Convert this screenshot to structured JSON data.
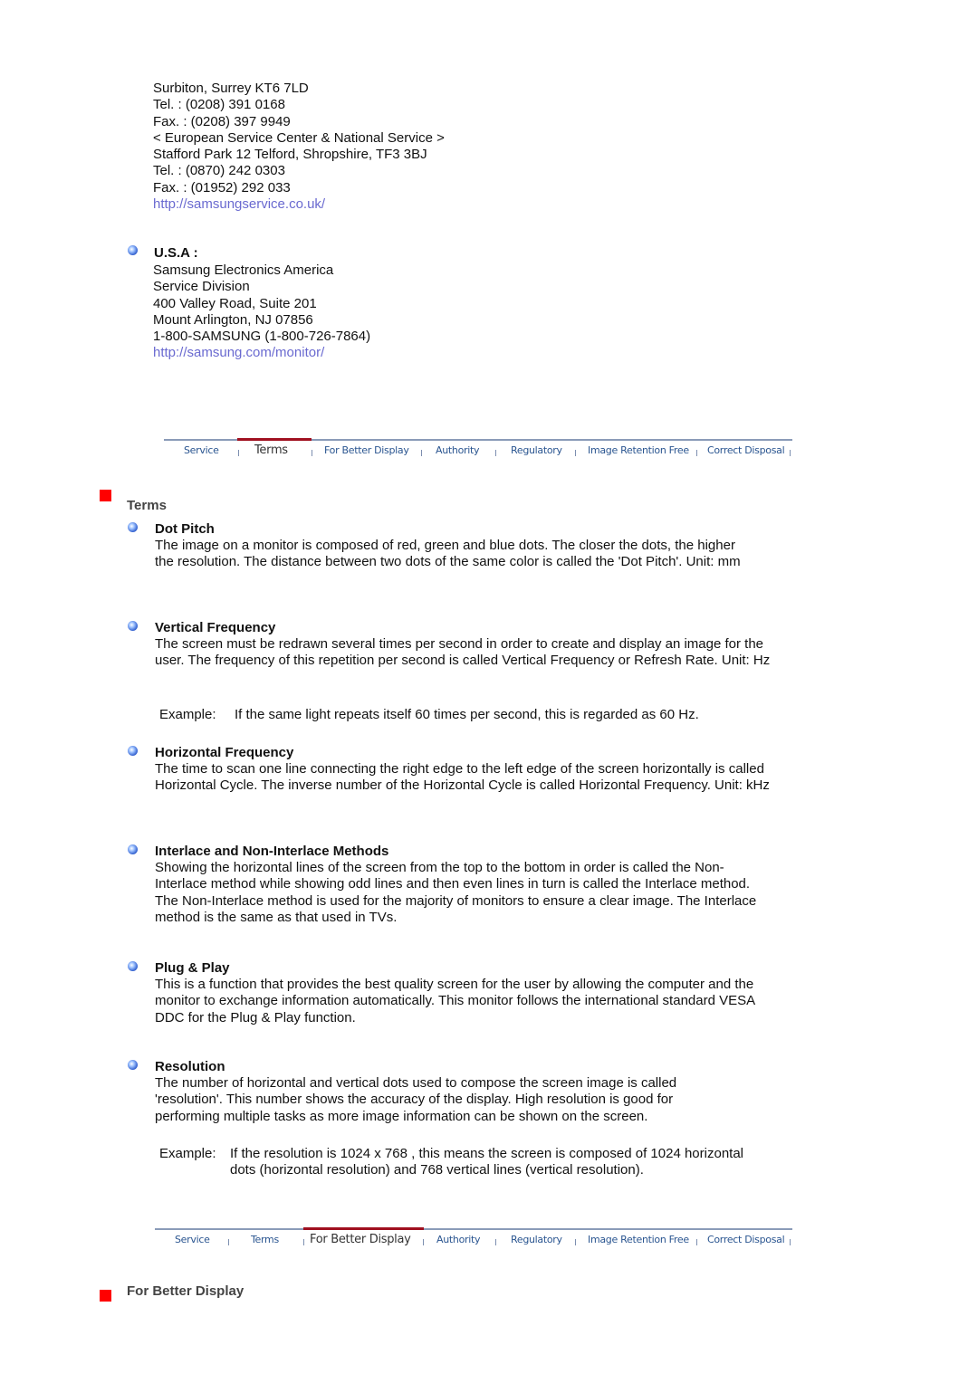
{
  "uk_contact": {
    "lines": [
      "Surbiton, Surrey KT6 7LD",
      "Tel. : (0208) 391 0168",
      "Fax. : (0208) 397 9949",
      "< European Service Center & National Service >",
      "Stafford Park 12 Telford, Shropshire, TF3 3BJ",
      "Tel. : (0870) 242 0303",
      "Fax. : (01952) 292 033"
    ],
    "link": "http://samsungservice.co.uk/"
  },
  "usa_contact": {
    "heading": "U.S.A :",
    "lines": [
      "Samsung Electronics America",
      "Service Division",
      "400 Valley Road, Suite 201",
      "Mount Arlington, NJ 07856",
      "1-800-SAMSUNG (1-800-726-7864)"
    ],
    "link": "http://samsung.com/monitor/"
  },
  "nav_tabs": [
    "Service",
    "Terms",
    "For Better Display",
    "Authority",
    "Regulatory",
    "Image Retention Free",
    "Correct Disposal"
  ],
  "colors": {
    "accent_red": "#ff0000",
    "active_tab_bar": "#a01020",
    "nav_text": "#2a5590",
    "link": "#6a6ad0"
  },
  "terms_section": {
    "title": "Terms",
    "active_tab": "Terms",
    "items": [
      {
        "heading": "Dot Pitch",
        "body": "The image on a monitor is composed of red, green and blue dots. The closer the dots, the higher the resolution. The distance between two dots of the same color is called the 'Dot Pitch'. Unit: mm"
      },
      {
        "heading": "Vertical Frequency",
        "body": "The screen must be redrawn several times per second in order to create and display an image for the user. The frequency of this repetition per second is called Vertical Frequency or Refresh Rate. Unit: Hz",
        "example_label": "Example:",
        "example_text": "If the same light repeats itself 60 times per second, this is regarded as 60 Hz."
      },
      {
        "heading": "Horizontal Frequency",
        "body": "The time to scan one line connecting the right edge to the left edge of the screen horizontally is called Horizontal Cycle. The inverse number of the Horizontal Cycle is called Horizontal Frequency. Unit: kHz"
      },
      {
        "heading": "Interlace and Non-Interlace Methods",
        "body": "Showing the horizontal lines of the screen from the top to the bottom in order is called the Non-Interlace method while showing odd lines and then even lines in turn is called the Interlace method. The Non-Interlace method is used for the majority of monitors to ensure a clear image. The Interlace method is the same as that used in TVs."
      },
      {
        "heading": "Plug & Play",
        "body": "This is a function that provides the best quality screen for the user by allowing the computer and the monitor to exchange information automatically. This monitor follows the international standard VESA DDC for the Plug & Play function."
      },
      {
        "heading": "Resolution",
        "body": "The number of horizontal and vertical dots used to compose the screen image is called 'resolution'. This number shows the accuracy of the display. High resolution is good for performing multiple tasks as more image information can be shown on the screen.",
        "example_label": "Example:",
        "example_text": "If the resolution is 1024 x 768 , this means the screen is composed of 1024 horizontal dots (horizontal resolution) and 768 vertical lines (vertical resolution)."
      }
    ]
  },
  "better_display_section": {
    "title": "For Better Display",
    "active_tab": "For Better Display"
  }
}
